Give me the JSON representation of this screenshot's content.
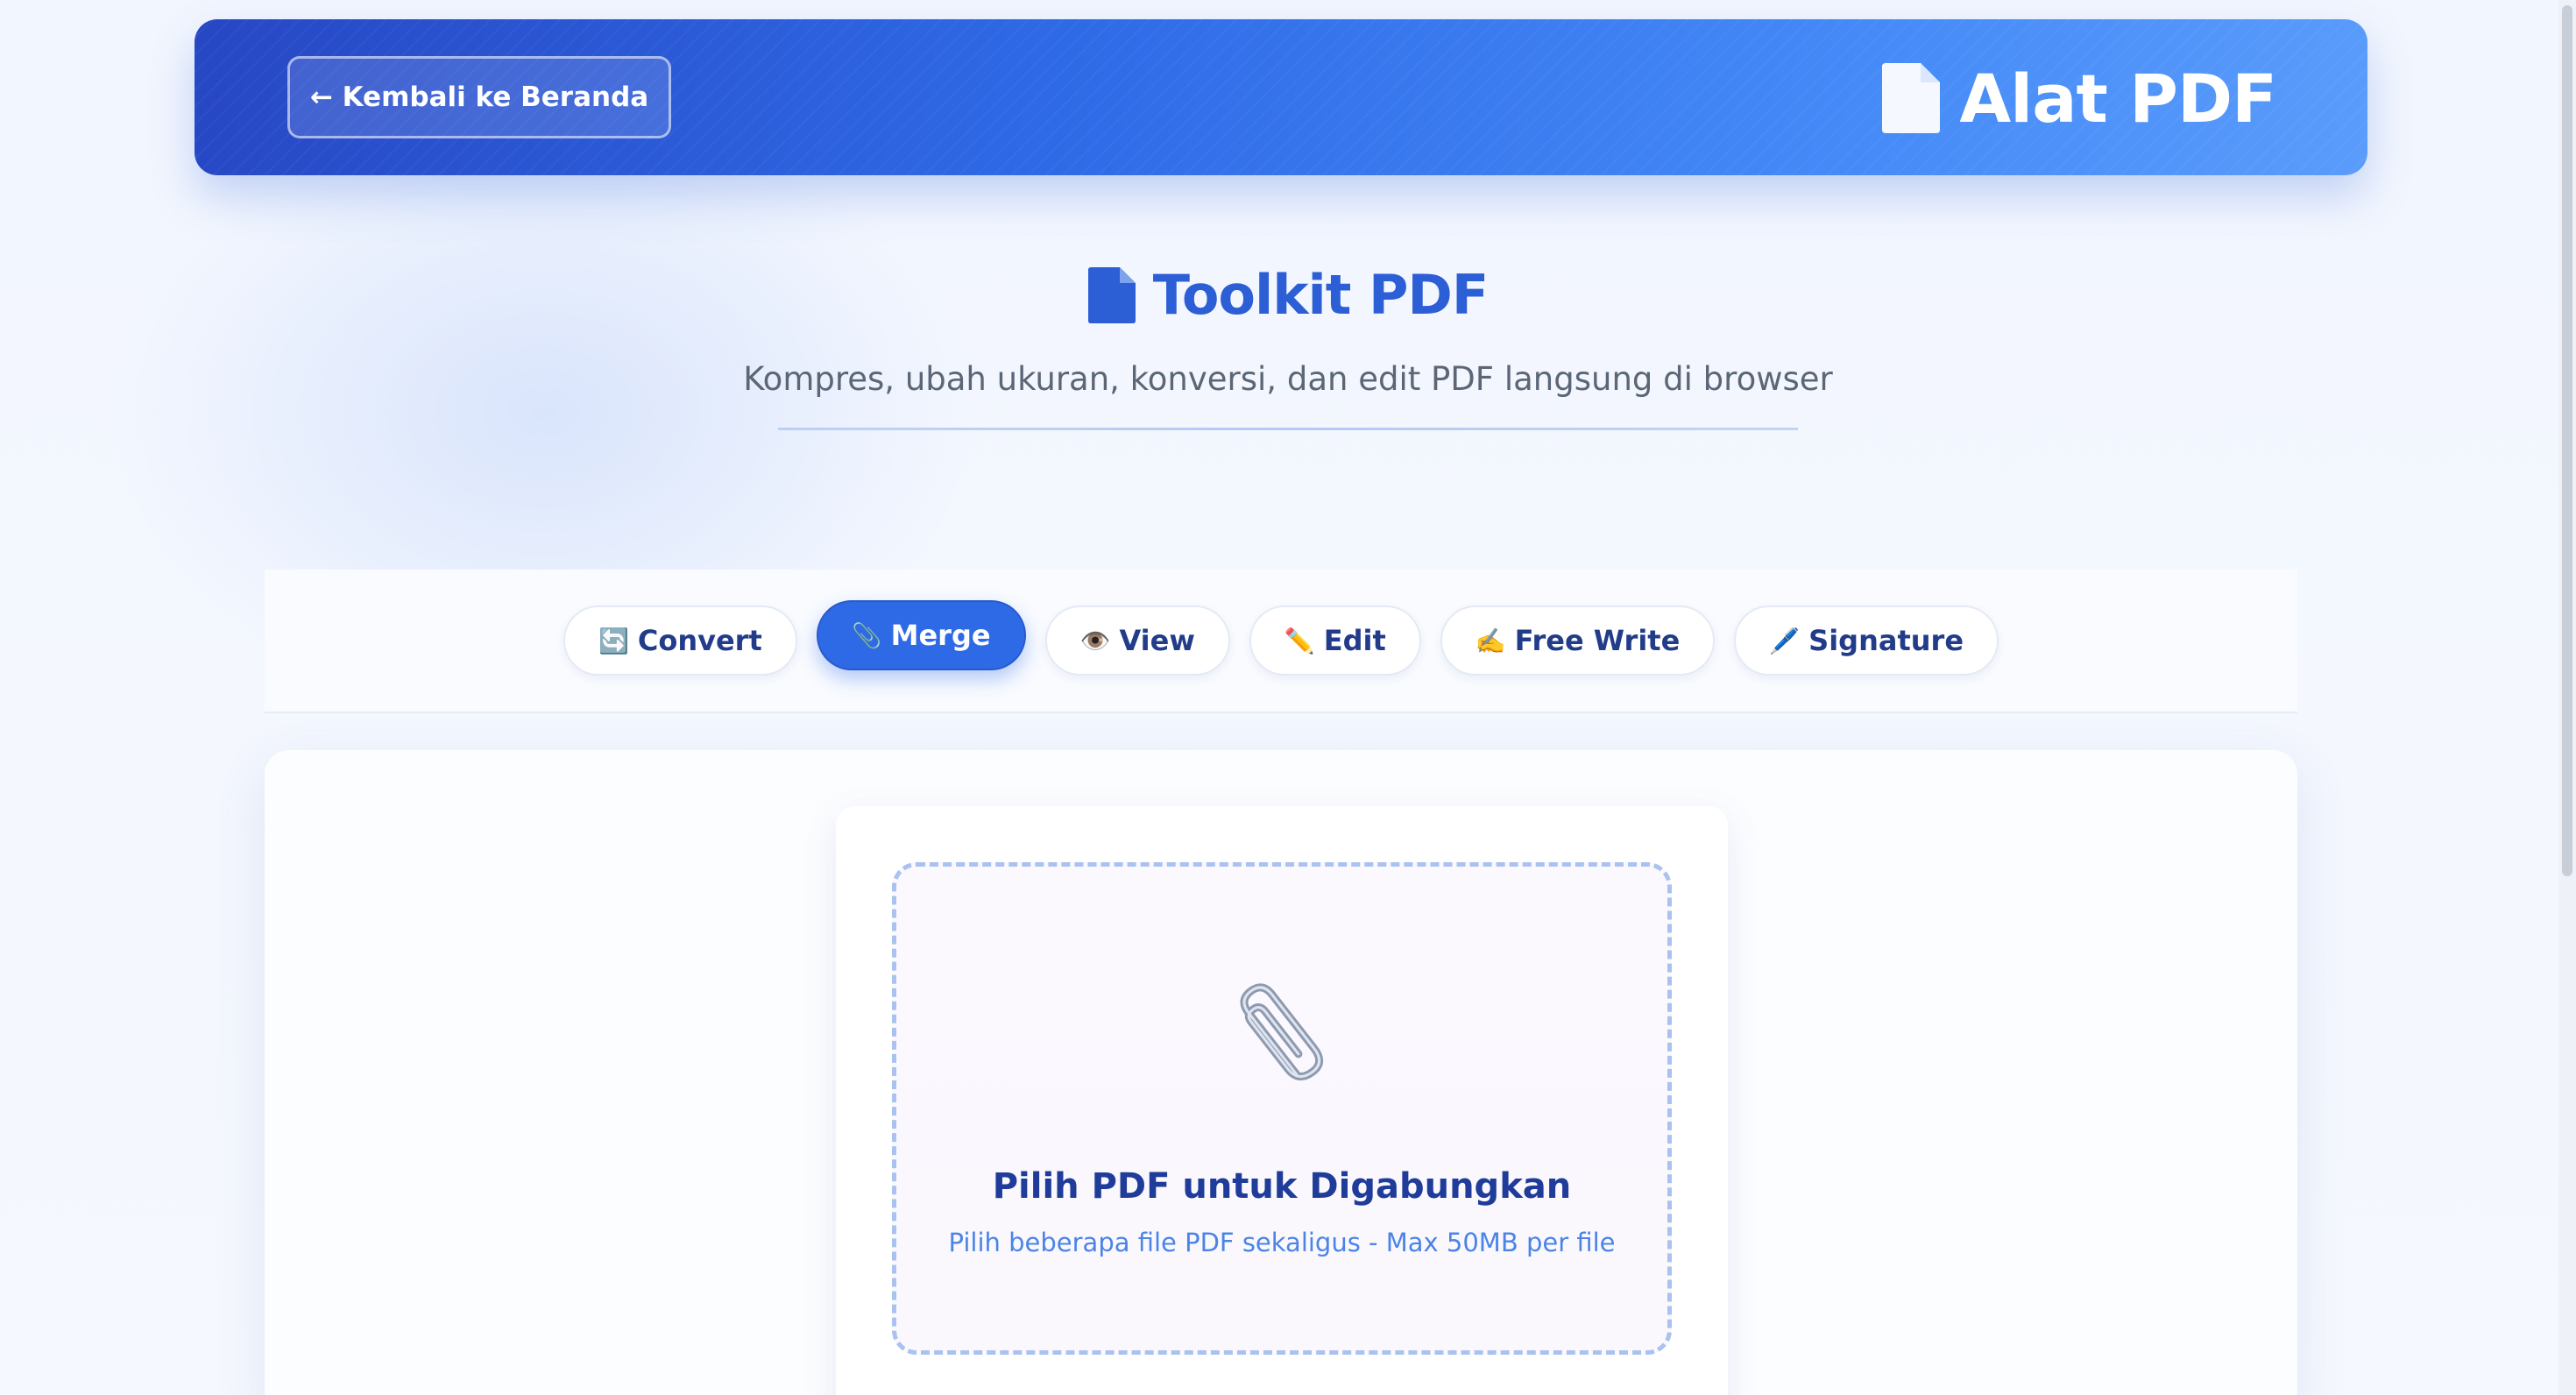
{
  "header": {
    "back_label": "← Kembali ke Beranda",
    "brand_icon": "document-icon",
    "brand_title": "Alat PDF"
  },
  "hero": {
    "icon": "document-icon",
    "title": "Toolkit PDF",
    "subtitle": "Kompres, ubah ukuran, konversi, dan edit PDF langsung di browser"
  },
  "tabs": [
    {
      "emoji": "🔄",
      "label": "Convert",
      "active": false
    },
    {
      "emoji": "📎",
      "label": "Merge",
      "active": true
    },
    {
      "emoji": "👁️",
      "label": "View",
      "active": false
    },
    {
      "emoji": "✏️",
      "label": "Edit",
      "active": false
    },
    {
      "emoji": "✍️",
      "label": "Free Write",
      "active": false
    },
    {
      "emoji": "🖊️",
      "label": "Signature",
      "active": false
    }
  ],
  "upload": {
    "icon": "paperclip-icon",
    "title": "Pilih PDF untuk Digabungkan",
    "subtitle": "Pilih beberapa file PDF sekaligus - Max 50MB per file"
  },
  "colors": {
    "primary": "#2f6ae6",
    "header_start": "#2747c4",
    "header_end": "#5a9cfb",
    "title_text": "#2c5ed6",
    "tab_text": "#223c8a",
    "dropzone_border": "#a9c2ef"
  }
}
